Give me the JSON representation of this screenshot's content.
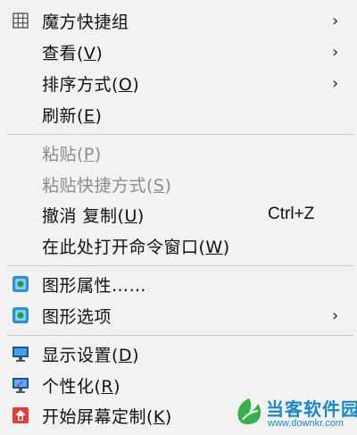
{
  "menu": {
    "items": [
      {
        "label": "魔方快捷组",
        "hotkey": "",
        "shortcut": "",
        "submenu": true,
        "disabled": false,
        "icon": "grid-icon"
      },
      {
        "label": "查看(",
        "hotkey": "V",
        "tail": ")",
        "shortcut": "",
        "submenu": true,
        "disabled": false
      },
      {
        "label": "排序方式(",
        "hotkey": "O",
        "tail": ")",
        "shortcut": "",
        "submenu": true,
        "disabled": false
      },
      {
        "label": "刷新(",
        "hotkey": "E",
        "tail": ")",
        "shortcut": "",
        "submenu": false,
        "disabled": false
      },
      {
        "label": "粘贴(",
        "hotkey": "P",
        "tail": ")",
        "shortcut": "",
        "submenu": false,
        "disabled": true
      },
      {
        "label": "粘贴快捷方式(",
        "hotkey": "S",
        "tail": ")",
        "shortcut": "",
        "submenu": false,
        "disabled": true
      },
      {
        "label": "撤消 复制(",
        "hotkey": "U",
        "tail": ")",
        "shortcut": "Ctrl+Z",
        "submenu": false,
        "disabled": false
      },
      {
        "label": "在此处打开命令窗口(",
        "hotkey": "W",
        "tail": ")",
        "shortcut": "",
        "submenu": false,
        "disabled": false
      },
      {
        "label": "图形属性……",
        "hotkey": "",
        "tail": "",
        "shortcut": "",
        "submenu": false,
        "disabled": false,
        "icon": "intel-graphics-icon"
      },
      {
        "label": "图形选项",
        "hotkey": "",
        "tail": "",
        "shortcut": "",
        "submenu": true,
        "disabled": false,
        "icon": "intel-graphics-icon"
      },
      {
        "label": "显示设置(",
        "hotkey": "D",
        "tail": ")",
        "shortcut": "",
        "submenu": false,
        "disabled": false,
        "icon": "display-settings-icon"
      },
      {
        "label": "个性化(",
        "hotkey": "R",
        "tail": ")",
        "shortcut": "",
        "submenu": false,
        "disabled": false,
        "icon": "personalize-icon"
      },
      {
        "label": "开始屏幕定制(",
        "hotkey": "K",
        "tail": ")",
        "shortcut": "",
        "submenu": false,
        "disabled": false,
        "icon": "start-screen-icon"
      }
    ],
    "chevron": "›"
  },
  "watermark": {
    "title": "当客软件园",
    "url": "www.downkr.com",
    "color": "#1a88c9"
  }
}
